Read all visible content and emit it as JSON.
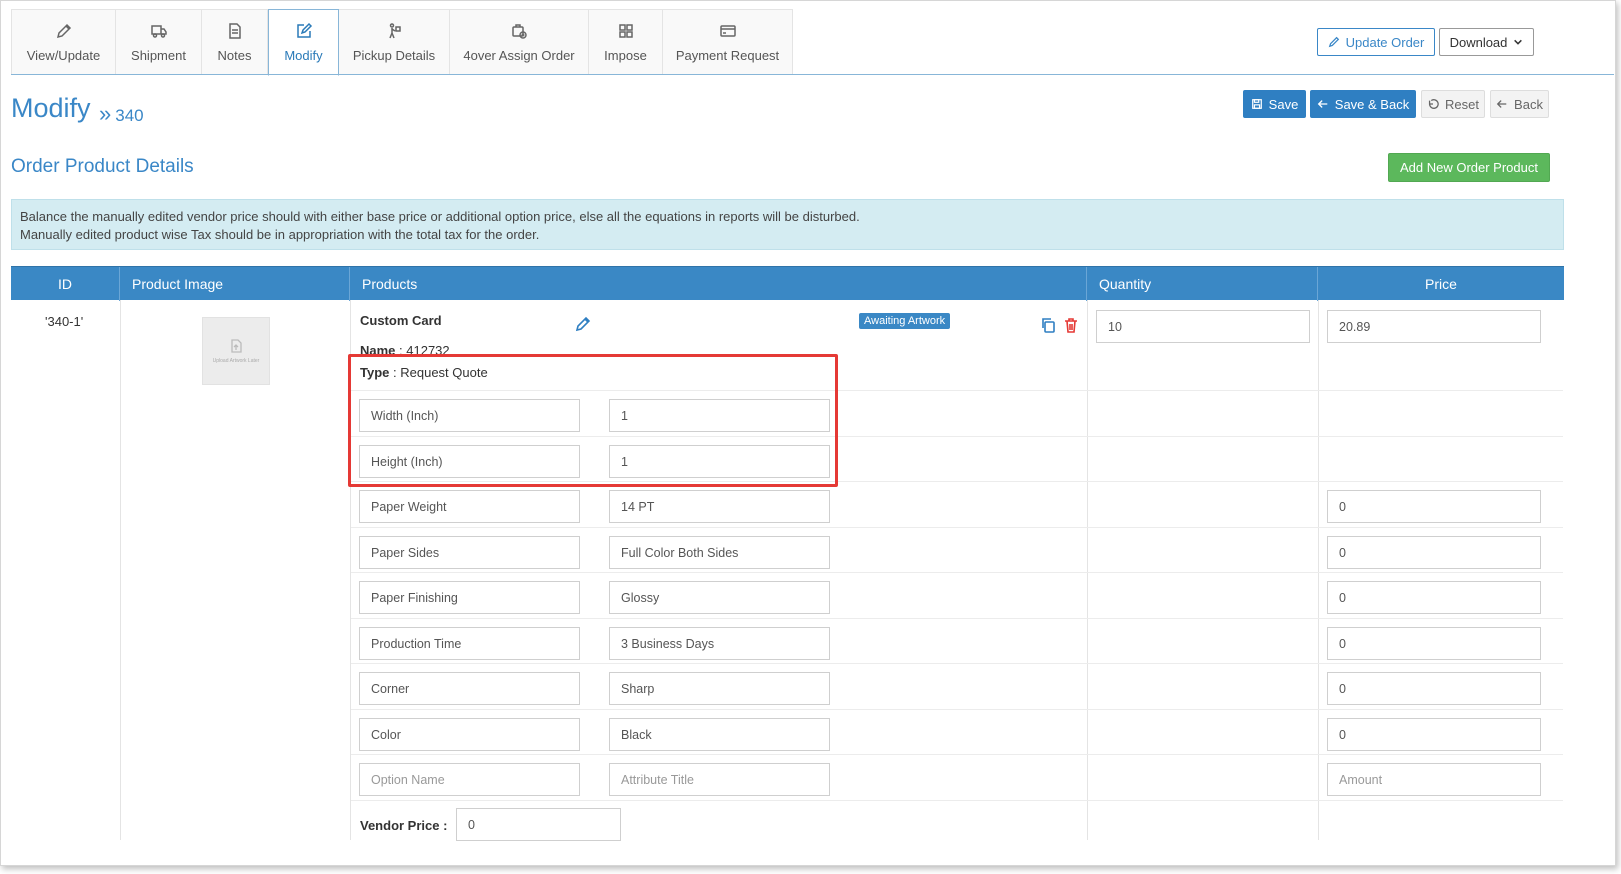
{
  "tabs": [
    {
      "label": "View/Update",
      "icon": "pencil-icon"
    },
    {
      "label": "Shipment",
      "icon": "truck-icon"
    },
    {
      "label": "Notes",
      "icon": "document-icon"
    },
    {
      "label": "Modify",
      "icon": "edit-square-icon",
      "active": true
    },
    {
      "label": "Pickup Details",
      "icon": "person-pickup-icon"
    },
    {
      "label": "4over Assign Order",
      "icon": "assign-icon"
    },
    {
      "label": "Impose",
      "icon": "grid-icon"
    },
    {
      "label": "Payment Request",
      "icon": "card-icon"
    }
  ],
  "header_buttons": {
    "update_order": "Update Order",
    "download": "Download"
  },
  "page": {
    "title": "Modify",
    "crumb": "340"
  },
  "actions": {
    "save": "Save",
    "save_back": "Save & Back",
    "reset": "Reset",
    "back": "Back"
  },
  "section": {
    "title": "Order Product Details",
    "add_button": "Add New Order Product"
  },
  "alert": {
    "line1": "Balance the manually edited vendor price should with either base price or additional option price, else all the equations in reports will be disturbed.",
    "line2": "Manually edited product wise Tax should be in appropriation with the total tax for the order."
  },
  "table": {
    "headers": {
      "id": "ID",
      "image": "Product Image",
      "products": "Products",
      "quantity": "Quantity",
      "price": "Price"
    },
    "row": {
      "id": "'340-1'",
      "image_caption": "Upload Artwork Later",
      "product_name": "Custom Card",
      "name_label": "Name",
      "name_value": "412732",
      "type_label": "Type",
      "type_value": "Request Quote",
      "status": "Awaiting Artwork",
      "quantity": "10",
      "price": "20.89",
      "options": [
        {
          "name": "Width (Inch)",
          "value": "1",
          "price": ""
        },
        {
          "name": "Height (Inch)",
          "value": "1",
          "price": ""
        },
        {
          "name": "Paper Weight",
          "value": "14 PT",
          "price": "0"
        },
        {
          "name": "Paper Sides",
          "value": "Full Color Both Sides",
          "price": "0"
        },
        {
          "name": "Paper Finishing",
          "value": "Glossy",
          "price": "0"
        },
        {
          "name": "Production Time",
          "value": "3 Business Days",
          "price": "0"
        },
        {
          "name": "Corner",
          "value": "Sharp",
          "price": "0"
        },
        {
          "name": "Color",
          "value": "Black",
          "price": "0"
        }
      ],
      "new_option": {
        "name_placeholder": "Option Name",
        "attr_placeholder": "Attribute Title",
        "amount_placeholder": "Amount"
      },
      "vendor_price_label": "Vendor Price :",
      "vendor_price": "0"
    }
  },
  "colors": {
    "accent": "#3a87c7",
    "header": "#3a88c5",
    "success": "#5cb85c",
    "danger": "#e53935",
    "alert_bg": "#d4ecf2"
  }
}
